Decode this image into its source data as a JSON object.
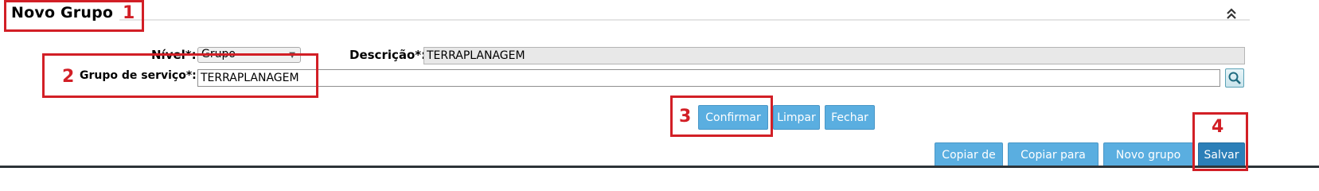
{
  "header": {
    "title": "Novo Grupo"
  },
  "form": {
    "nivel_label": "Nível*:",
    "nivel_value": "Grupo",
    "descricao_label": "Descrição*:",
    "descricao_value": "TERRAPLANAGEM",
    "grupo_servico_label": "Grupo de serviço*:",
    "grupo_servico_value": "TERRAPLANAGEM"
  },
  "actions": {
    "confirmar": "Confirmar",
    "limpar": "Limpar",
    "fechar": "Fechar"
  },
  "footer": {
    "copiar_de": "Copiar de",
    "copiar_para": "Copiar para",
    "novo_grupo": "Novo grupo",
    "salvar": "Salvar"
  },
  "annotations": {
    "n1": "1",
    "n2": "2",
    "n3": "3",
    "n4": "4"
  },
  "colors": {
    "button": "#5aaee0",
    "button_primary": "#2c7fb8",
    "annotation": "#d21f26"
  },
  "icons": {
    "collapse": "double-chevron-up-icon",
    "search": "magnifier-icon",
    "select": "chevron-down-icon"
  }
}
